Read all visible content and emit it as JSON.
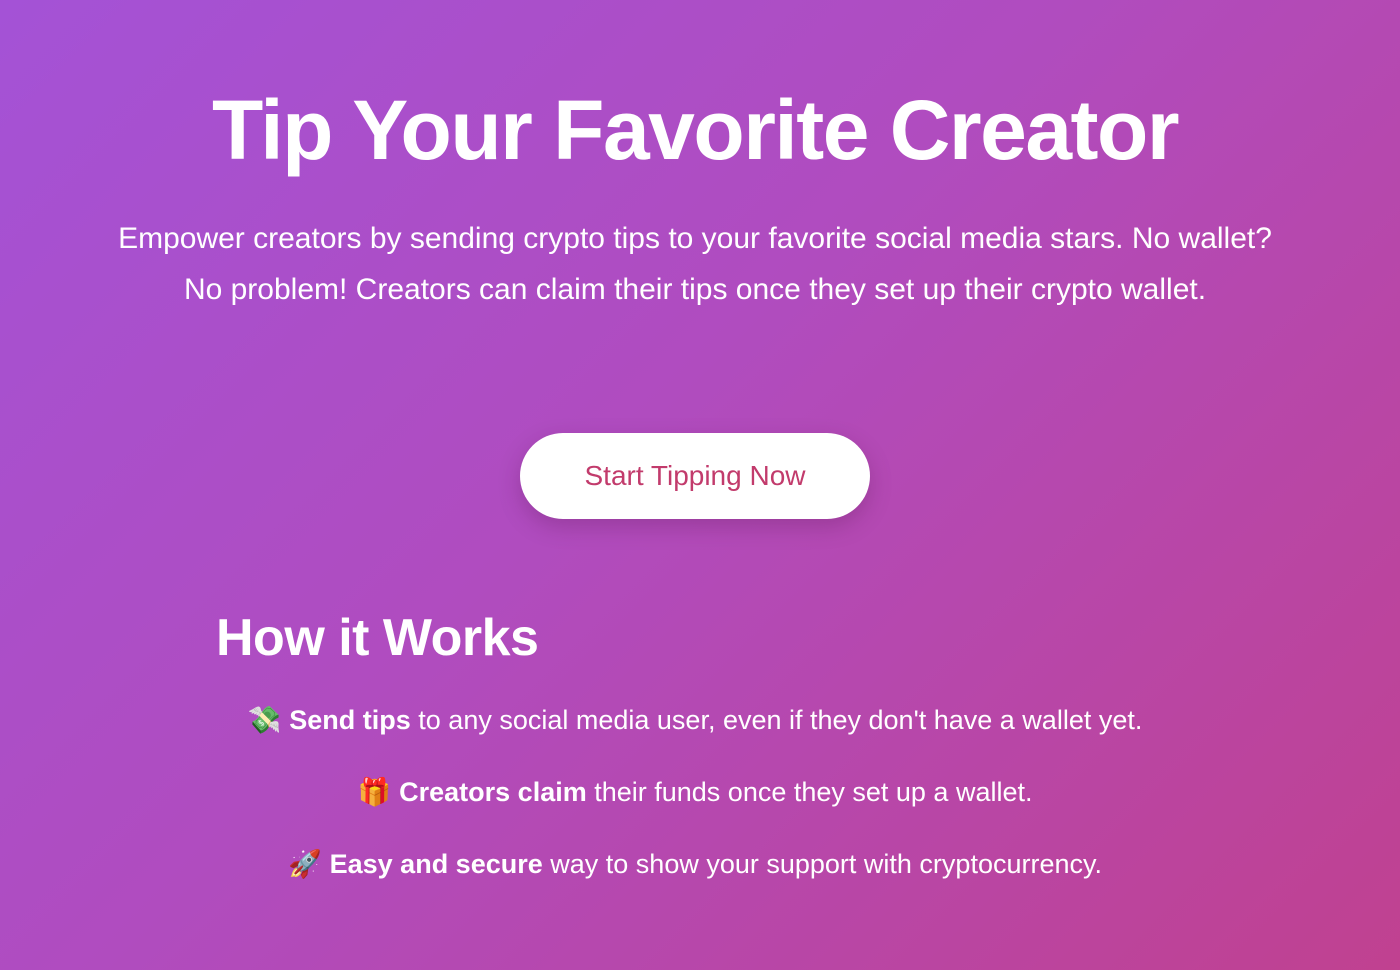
{
  "hero": {
    "title": "Tip Your Favorite Creator",
    "subtitle": "Empower creators by sending crypto tips to your favorite social media stars. No wallet? No problem! Creators can claim their tips once they set up their crypto wallet.",
    "cta_label": "Start Tipping Now"
  },
  "how_it_works": {
    "title": "How it Works",
    "steps": [
      {
        "icon": "money-with-wings-icon",
        "glyph": "💸",
        "bold": "Send tips",
        "text": " to any social media user, even if they don't have a wallet yet."
      },
      {
        "icon": "gift-icon",
        "glyph": "🎁",
        "bold": "Creators claim",
        "text": " their funds once they set up a wallet."
      },
      {
        "icon": "rocket-icon",
        "glyph": "🚀",
        "bold": "Easy and secure",
        "text": " way to show your support with cryptocurrency."
      }
    ]
  },
  "colors": {
    "background_start": "#a452d6",
    "background_end": "#c04190",
    "button_bg": "#ffffff",
    "button_text": "#c23b6c",
    "text": "#ffffff"
  }
}
